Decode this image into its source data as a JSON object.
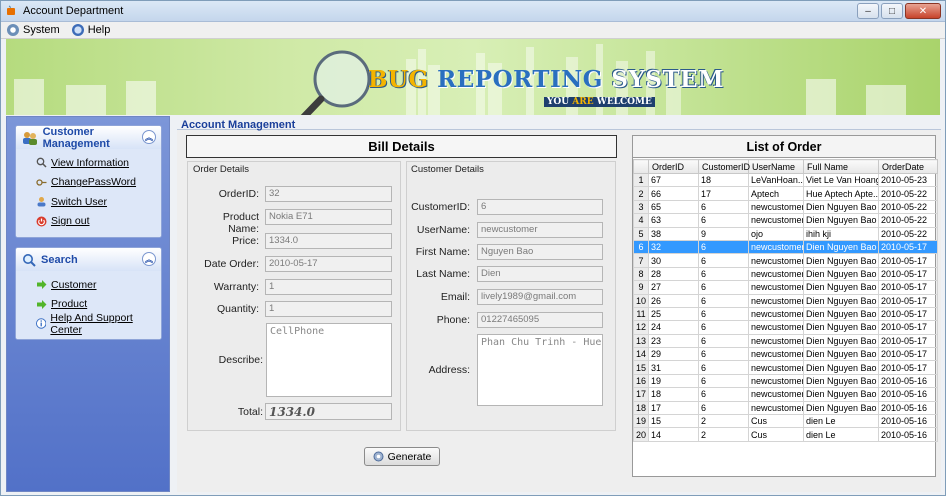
{
  "window": {
    "title": "Account Department",
    "controls": {
      "minimize": "–",
      "maximize": "□",
      "close": "✕"
    }
  },
  "menu": [
    {
      "label": "System",
      "icon": "gear-icon"
    },
    {
      "label": "Help",
      "icon": "help-icon"
    }
  ],
  "banner": {
    "title_part1": "BUG",
    "title_part2": " REPORTING",
    "title_part3": " SYSTEM",
    "subtitle_a": "YOU ",
    "subtitle_b": "ARE",
    "subtitle_c": " WELCOME"
  },
  "sidebar": {
    "customer_management": {
      "title": "Customer Management",
      "items": [
        {
          "label": "View Information",
          "icon": "magnifier-icon"
        },
        {
          "label": "ChangePassWord",
          "icon": "key-icon"
        },
        {
          "label": "Switch User",
          "icon": "switch-user-icon"
        },
        {
          "label": "Sign out",
          "icon": "power-icon"
        }
      ]
    },
    "search": {
      "title": "Search",
      "items": [
        {
          "label": "Customer",
          "icon": "green-arrow-icon"
        },
        {
          "label": "Product",
          "icon": "green-arrow-icon"
        },
        {
          "label": "Help And Support Center",
          "icon": "info-icon"
        }
      ]
    }
  },
  "section_title": "Account Management",
  "bill": {
    "header": "Bill Details",
    "order_details": {
      "title": "Order Details",
      "order_id_label": "OrderID:",
      "order_id": "32",
      "product_name_label": "Product Name:",
      "product_name": "Nokia E71",
      "price_label": "Price:",
      "price": "1334.0",
      "date_order_label": "Date Order:",
      "date_order": "2010-05-17",
      "warranty_label": "Warranty:",
      "warranty": "1",
      "quantity_label": "Quantity:",
      "quantity": "1",
      "describe_label": "Describe:",
      "describe": "CellPhone",
      "total_label": "Total:",
      "total": "1334.0"
    },
    "customer_details": {
      "title": "Customer Details",
      "customer_id_label": "CustomerID:",
      "customer_id": "6",
      "username_label": "UserName:",
      "username": "newcustomer",
      "first_name_label": "First Name:",
      "first_name": "Nguyen Bao",
      "last_name_label": "Last Name:",
      "last_name": "Dien",
      "email_label": "Email:",
      "email": "lively1989@gmail.com",
      "phone_label": "Phone:",
      "phone": "01227465095",
      "address_label": "Address:",
      "address": "Phan Chu Trinh - Hue"
    },
    "generate_button": "Generate"
  },
  "orders": {
    "title": "List of Order",
    "columns": [
      "",
      "OrderID",
      "CustomerID",
      "UserName",
      "Full Name",
      "OrderDate"
    ],
    "selected_index": 5,
    "rows": [
      [
        "1",
        "67",
        "18",
        "LeVanHoan...",
        "Viet Le Van Hoang",
        "2010-05-23"
      ],
      [
        "2",
        "66",
        "17",
        "Aptech",
        "Hue Aptech Apte...",
        "2010-05-22"
      ],
      [
        "3",
        "65",
        "6",
        "newcustomer",
        "Dien Nguyen Bao",
        "2010-05-22"
      ],
      [
        "4",
        "63",
        "6",
        "newcustomer",
        "Dien Nguyen Bao",
        "2010-05-22"
      ],
      [
        "5",
        "38",
        "9",
        "ojo",
        "ihih kji",
        "2010-05-22"
      ],
      [
        "6",
        "32",
        "6",
        "newcustomer",
        "Dien Nguyen Bao",
        "2010-05-17"
      ],
      [
        "7",
        "30",
        "6",
        "newcustomer",
        "Dien Nguyen Bao",
        "2010-05-17"
      ],
      [
        "8",
        "28",
        "6",
        "newcustomer",
        "Dien Nguyen Bao",
        "2010-05-17"
      ],
      [
        "9",
        "27",
        "6",
        "newcustomer",
        "Dien Nguyen Bao",
        "2010-05-17"
      ],
      [
        "10",
        "26",
        "6",
        "newcustomer",
        "Dien Nguyen Bao",
        "2010-05-17"
      ],
      [
        "11",
        "25",
        "6",
        "newcustomer",
        "Dien Nguyen Bao",
        "2010-05-17"
      ],
      [
        "12",
        "24",
        "6",
        "newcustomer",
        "Dien Nguyen Bao",
        "2010-05-17"
      ],
      [
        "13",
        "23",
        "6",
        "newcustomer",
        "Dien Nguyen Bao",
        "2010-05-17"
      ],
      [
        "14",
        "29",
        "6",
        "newcustomer",
        "Dien Nguyen Bao",
        "2010-05-17"
      ],
      [
        "15",
        "31",
        "6",
        "newcustomer",
        "Dien Nguyen Bao",
        "2010-05-17"
      ],
      [
        "16",
        "19",
        "6",
        "newcustomer",
        "Dien Nguyen Bao",
        "2010-05-16"
      ],
      [
        "17",
        "18",
        "6",
        "newcustomer",
        "Dien Nguyen Bao",
        "2010-05-16"
      ],
      [
        "18",
        "17",
        "6",
        "newcustomer",
        "Dien Nguyen Bao",
        "2010-05-16"
      ],
      [
        "19",
        "15",
        "2",
        "Cus",
        "dien Le",
        "2010-05-16"
      ],
      [
        "20",
        "14",
        "2",
        "Cus",
        "dien Le",
        "2010-05-16"
      ]
    ]
  }
}
